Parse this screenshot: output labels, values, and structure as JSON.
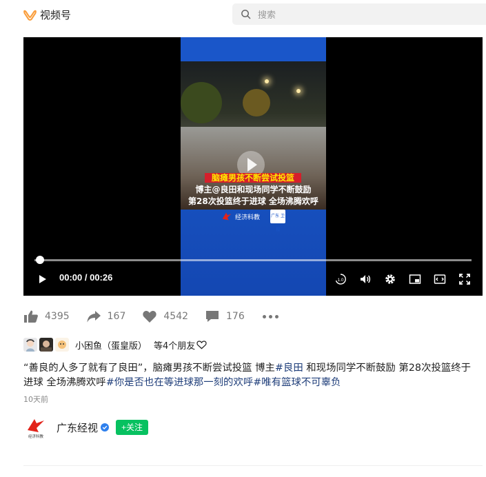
{
  "app": {
    "name": "视频号",
    "brand_color": "#fa9d3b"
  },
  "search": {
    "placeholder": "搜索"
  },
  "video": {
    "caption_lines": [
      "脑瘫男孩不断尝试投篮",
      "博主@良田和现场同学不断鼓励",
      "第28次投篮终于进球 全场沸腾欢呼"
    ],
    "watermark": "经济科教",
    "watermark2": "广东 卫视",
    "current_time": "00:00",
    "duration": "00:26",
    "time_display": "00:00 / 00:26",
    "progress_fraction": 0.0,
    "speed_label": "1.0"
  },
  "stats": {
    "likes": "4395",
    "shares": "167",
    "favorites": "4542",
    "comments": "176"
  },
  "friends": {
    "name": "小困鱼（蛋皇版）",
    "more_text": "等4个朋友"
  },
  "description": {
    "text_before": "“善良的人多了就有了良田”，脑瘫男孩不断尝试投篮 博主",
    "tag1": "#良田",
    "text_middle": " 和现场同学不断鼓励 第28次投篮终于进球 全场沸腾欢呼",
    "tag2": "#你是否也在等进球那一刻的欢呼",
    "tag3": "#唯有篮球不可辜负"
  },
  "posted": "10天前",
  "author": {
    "name": "广东经视",
    "avatar_caption": "经济科教",
    "follow_label": "+关注",
    "follow_color": "#07c160"
  }
}
